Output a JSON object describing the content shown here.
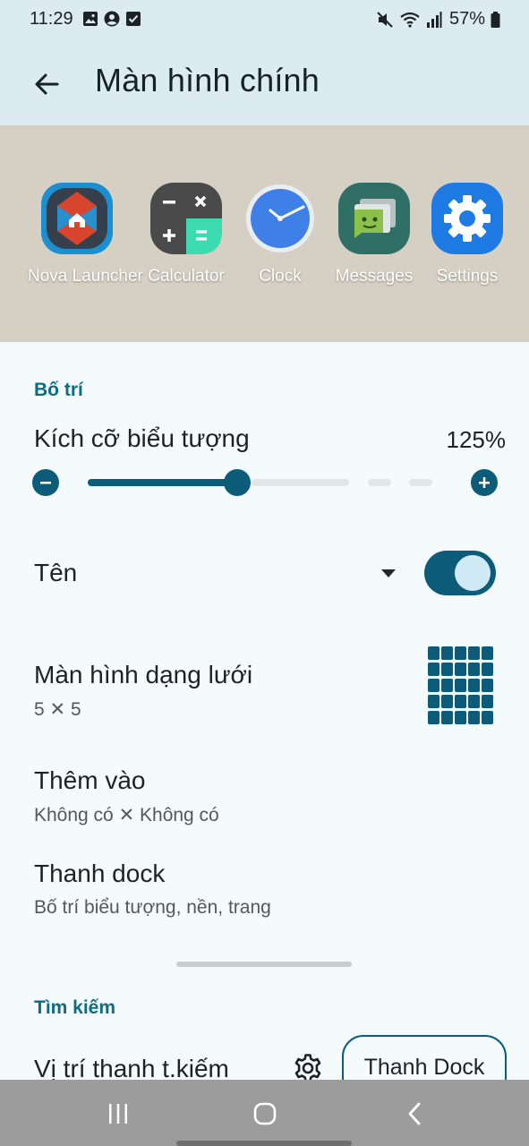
{
  "status_bar": {
    "time": "11:29",
    "battery_percent": "57%",
    "left_icons": [
      "gallery-icon",
      "account-icon",
      "checkbox-icon"
    ],
    "right_icons": [
      "mute-icon",
      "wifi-icon",
      "signal-icon",
      "battery-icon"
    ]
  },
  "appbar": {
    "title": "Màn hình chính",
    "back_icon": "arrow-back-icon"
  },
  "preview": {
    "apps": [
      {
        "label": "Nova Launcher",
        "icon": "nova-launcher-icon",
        "color": "#d8452e"
      },
      {
        "label": "Calculator",
        "icon": "calculator-icon",
        "color": "#4a4a4a"
      },
      {
        "label": "Clock",
        "icon": "clock-icon",
        "color": "#3f7fe8"
      },
      {
        "label": "Messages",
        "icon": "messages-icon",
        "color": "#2f6f66"
      },
      {
        "label": "Settings",
        "icon": "settings-icon",
        "color": "#1e7be3"
      }
    ]
  },
  "layout_section": {
    "header": "Bố trí",
    "icon_size": {
      "title": "Kích cỡ biểu tượng",
      "value": "125%",
      "slider_fraction": 0.5
    },
    "label_row": {
      "title": "Tên",
      "toggle_on": true
    },
    "grid": {
      "title": "Màn hình dạng lưới",
      "subtitle": "5 ✕ 5"
    },
    "add_to": {
      "title": "Thêm vào",
      "subtitle": "Không có ✕ Không có"
    },
    "dock": {
      "title": "Thanh dock",
      "subtitle": "Bố trí biểu tượng, nền, trang"
    }
  },
  "search_section": {
    "header": "Tìm kiếm",
    "position": {
      "title": "Vị trí thanh t.kiếm",
      "button": "Thanh Dock"
    }
  },
  "colors": {
    "accent": "#0c5b78",
    "header_bg": "#dcebf1",
    "section_header": "#0f6b80"
  }
}
